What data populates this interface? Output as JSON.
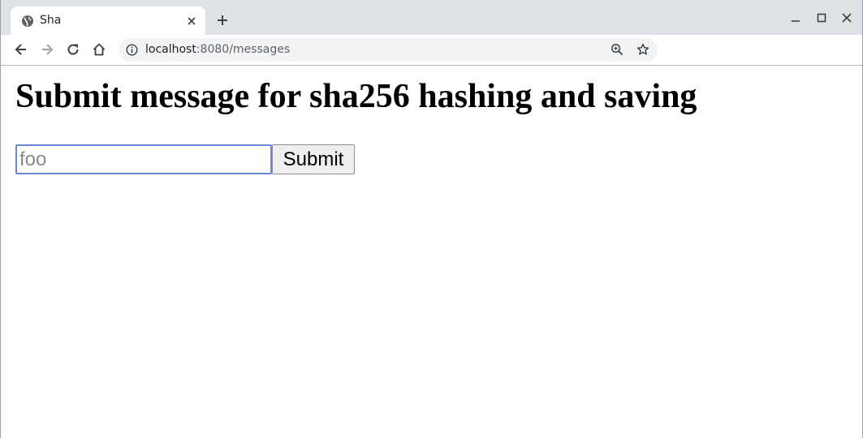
{
  "browser": {
    "tab_title": "Sha",
    "url_host": "localhost",
    "url_rest": ":8080/messages"
  },
  "page": {
    "heading": "Submit message for sha256 hashing and saving",
    "input_placeholder": "foo",
    "submit_label": "Submit"
  },
  "colors": {
    "tabstrip_bg": "#dee1e6",
    "omnibox_bg": "#f1f3f4",
    "input_focus_border": "#6f86d6"
  }
}
